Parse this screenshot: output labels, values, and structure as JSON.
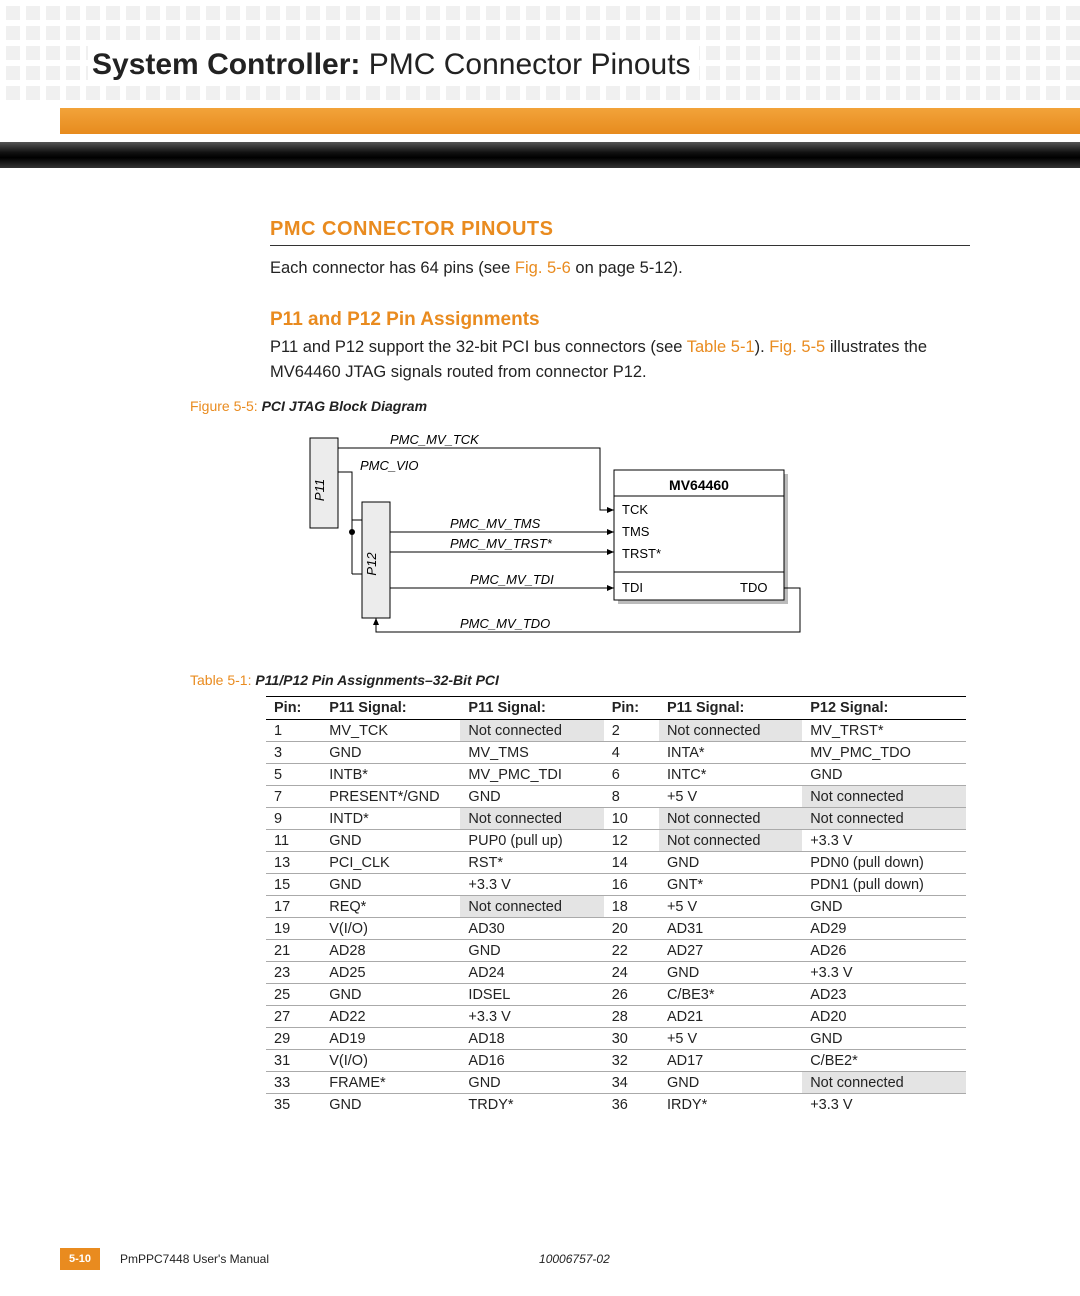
{
  "header": {
    "title_bold": "System Controller:",
    "title_light": "  PMC Connector Pinouts"
  },
  "section": {
    "h1": "PMC CONNECTOR PINOUTS",
    "intro_pre": "Each connector has 64 pins (see ",
    "intro_ref": "Fig. 5-6",
    "intro_post": " on page 5-12).",
    "h2": "P11 and P12 Pin Assignments",
    "p2_a": "P11 and P12 support the 32-bit PCI bus connectors (see ",
    "p2_ref1": "Table 5-1",
    "p2_b": "). ",
    "p2_ref2": "Fig. 5-5",
    "p2_c": " illustrates the MV64460 JTAG signals routed from connector P12."
  },
  "figure": {
    "tag": "Figure 5-5:",
    "title": "PCI JTAG Block Diagram",
    "labels": {
      "p11": "P11",
      "p12": "P12",
      "mv": "MV64460",
      "tck": "TCK",
      "tms": "TMS",
      "trst": "TRST*",
      "tdi": "TDI",
      "tdo": "TDO",
      "pmc_mv_tck": "PMC_MV_TCK",
      "pmc_vio": "PMC_VIO",
      "pmc_mv_tms": "PMC_MV_TMS",
      "pmc_mv_trst": "PMC_MV_TRST*",
      "pmc_mv_tdi": "PMC_MV_TDI",
      "pmc_mv_tdo": "PMC_MV_TDO"
    }
  },
  "table": {
    "tag": "Table 5-1:",
    "title": "P11/P12 Pin Assignments–32-Bit PCI",
    "headers": [
      "Pin:",
      "P11 Signal:",
      "P11 Signal:",
      "Pin:",
      "P11 Signal:",
      "P12 Signal:"
    ],
    "rows": [
      [
        "1",
        "MV_TCK",
        "Not connected",
        "2",
        "Not connected",
        "MV_TRST*"
      ],
      [
        "3",
        "GND",
        "MV_TMS",
        "4",
        "INTA*",
        "MV_PMC_TDO"
      ],
      [
        "5",
        "INTB*",
        "MV_PMC_TDI",
        "6",
        "INTC*",
        "GND"
      ],
      [
        "7",
        "PRESENT*/GND",
        "GND",
        "8",
        "+5 V",
        "Not connected"
      ],
      [
        "9",
        "INTD*",
        "Not connected",
        "10",
        "Not connected",
        "Not connected"
      ],
      [
        "11",
        "GND",
        "PUP0 (pull up)",
        "12",
        "Not connected",
        "+3.3 V"
      ],
      [
        "13",
        "PCI_CLK",
        "RST*",
        "14",
        "GND",
        "PDN0 (pull down)"
      ],
      [
        "15",
        "GND",
        "+3.3 V",
        "16",
        "GNT*",
        "PDN1 (pull down)"
      ],
      [
        "17",
        "REQ*",
        "Not connected",
        "18",
        "+5 V",
        "GND"
      ],
      [
        "19",
        "V(I/O)",
        "AD30",
        "20",
        "AD31",
        "AD29"
      ],
      [
        "21",
        "AD28",
        "GND",
        "22",
        "AD27",
        "AD26"
      ],
      [
        "23",
        "AD25",
        "AD24",
        "24",
        "GND",
        "+3.3 V"
      ],
      [
        "25",
        "GND",
        "IDSEL",
        "26",
        "C/BE3*",
        "AD23"
      ],
      [
        "27",
        "AD22",
        "+3.3 V",
        "28",
        "AD21",
        "AD20"
      ],
      [
        "29",
        "AD19",
        "AD18",
        "30",
        "+5 V",
        "GND"
      ],
      [
        "31",
        "V(I/O)",
        "AD16",
        "32",
        "AD17",
        "C/BE2*"
      ],
      [
        "33",
        "FRAME*",
        "GND",
        "34",
        "GND",
        "Not connected"
      ],
      [
        "35",
        "GND",
        "TRDY*",
        "36",
        "IRDY*",
        "+3.3 V"
      ]
    ]
  },
  "footer": {
    "page": "5-10",
    "manual": "PmPPC7448 User's Manual",
    "docid": "10006757-02"
  }
}
